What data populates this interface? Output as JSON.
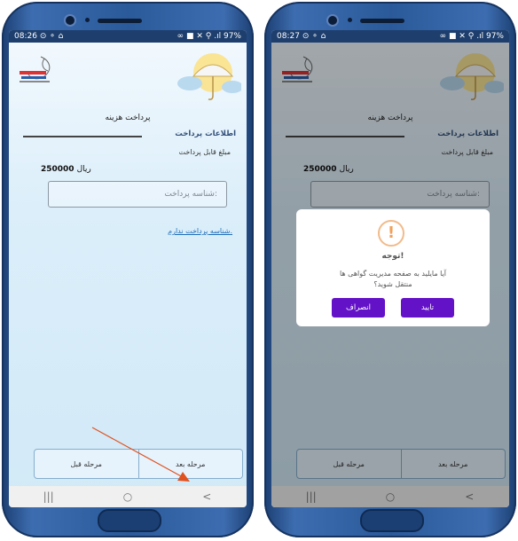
{
  "left_phone": {
    "status": {
      "time": "08:26",
      "left_icons": "⊙ ⚬ ⌂",
      "right_icons": "∞ ■ ✕ ⚲ .ıl",
      "battery": "97%"
    },
    "page_title": "پرداخت هزینه",
    "section_label": "اطلاعات پرداخت",
    "amount_label": "مبلغ قابل پرداخت",
    "amount_value": "250000",
    "amount_unit": "ریال",
    "id_placeholder": "شناسه پرداخت:",
    "no_id_link": "شناسه پرداخت ندارم.",
    "next_button": "مرحله بعد",
    "prev_button": "مرحله قبل",
    "nav": {
      "recent": "|||",
      "home": "○",
      "back": "<"
    }
  },
  "right_phone": {
    "status": {
      "time": "08:27",
      "left_icons": "⊙ ⚬ ⌂",
      "right_icons": "∞ ■ ✕ ⚲ .ıl",
      "battery": "97%"
    },
    "page_title": "پرداخت هزینه",
    "section_label": "اطلاعات پرداخت",
    "amount_label": "مبلغ قابل پرداخت",
    "amount_value": "250000",
    "amount_unit": "ریال",
    "id_placeholder": "شناسه پرداخت:",
    "next_button": "مرحله بعد",
    "prev_button": "مرحله قبل",
    "nav": {
      "recent": "|||",
      "home": "○",
      "back": "<"
    },
    "dialog": {
      "icon": "!",
      "title": "توجه!",
      "message_line1": "آیا مایلید به صفحه مدیریت گواهی ها",
      "message_line2": "منتقل شوید؟",
      "confirm": "تایید",
      "cancel": "انصراف"
    }
  },
  "colors": {
    "dialog_button": "#6412c8",
    "arrow": "#e0521f",
    "link": "#1e6db8"
  }
}
